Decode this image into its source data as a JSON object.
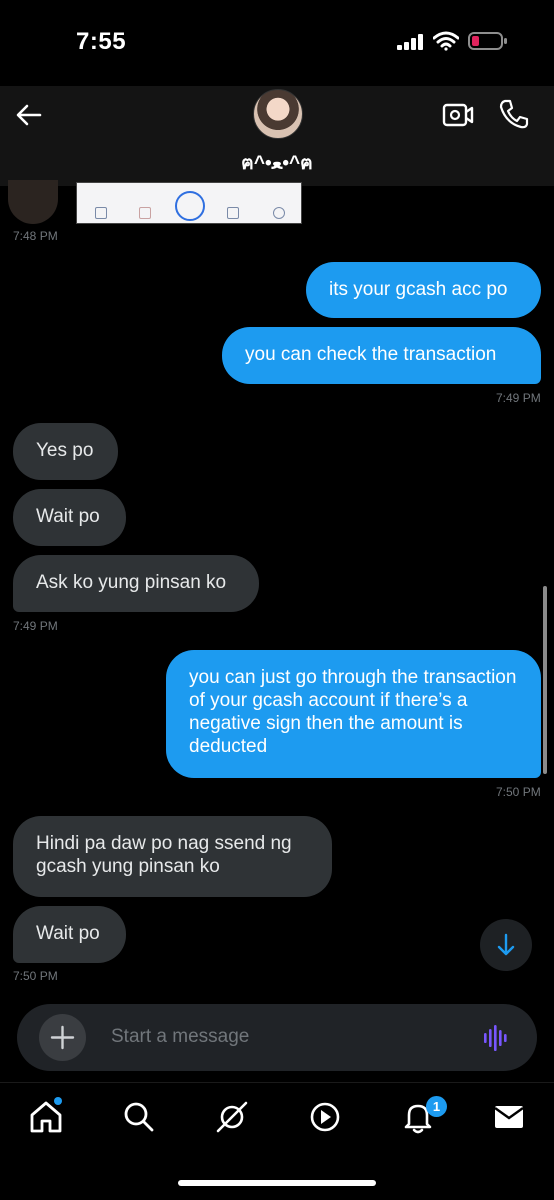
{
  "status_bar": {
    "time": "7:55"
  },
  "header": {
    "contact_name": "ฅ^•ﻌ•^ฅ"
  },
  "messages": [
    {
      "text": "its your gcash acc po"
    },
    {
      "text": "you can check the transaction"
    },
    {
      "text": "Yes po"
    },
    {
      "text": "Wait po"
    },
    {
      "text": "Ask ko yung pinsan ko"
    },
    {
      "text": "you can just go through the transaction of your gcash account if there’s a negative sign then the amount is deducted"
    },
    {
      "text": "Hindi pa daw po nag ssend ng gcash yung pinsan ko"
    },
    {
      "text": "Wait po"
    }
  ],
  "timestamps": [
    "7:48 PM",
    "7:49 PM",
    "7:49 PM",
    "7:50 PM",
    "7:50 PM"
  ],
  "composer": {
    "placeholder": "Start a message"
  },
  "bottom_nav": {
    "items": [
      "home-icon",
      "search-icon",
      "grok-icon",
      "video-icon",
      "notifications-icon",
      "messages-icon"
    ],
    "notification_count": "1"
  },
  "colors": {
    "accent": "#1d9bf0",
    "received_bubble": "#2f3336",
    "background": "#000000",
    "battery_low": "#e0245e"
  }
}
